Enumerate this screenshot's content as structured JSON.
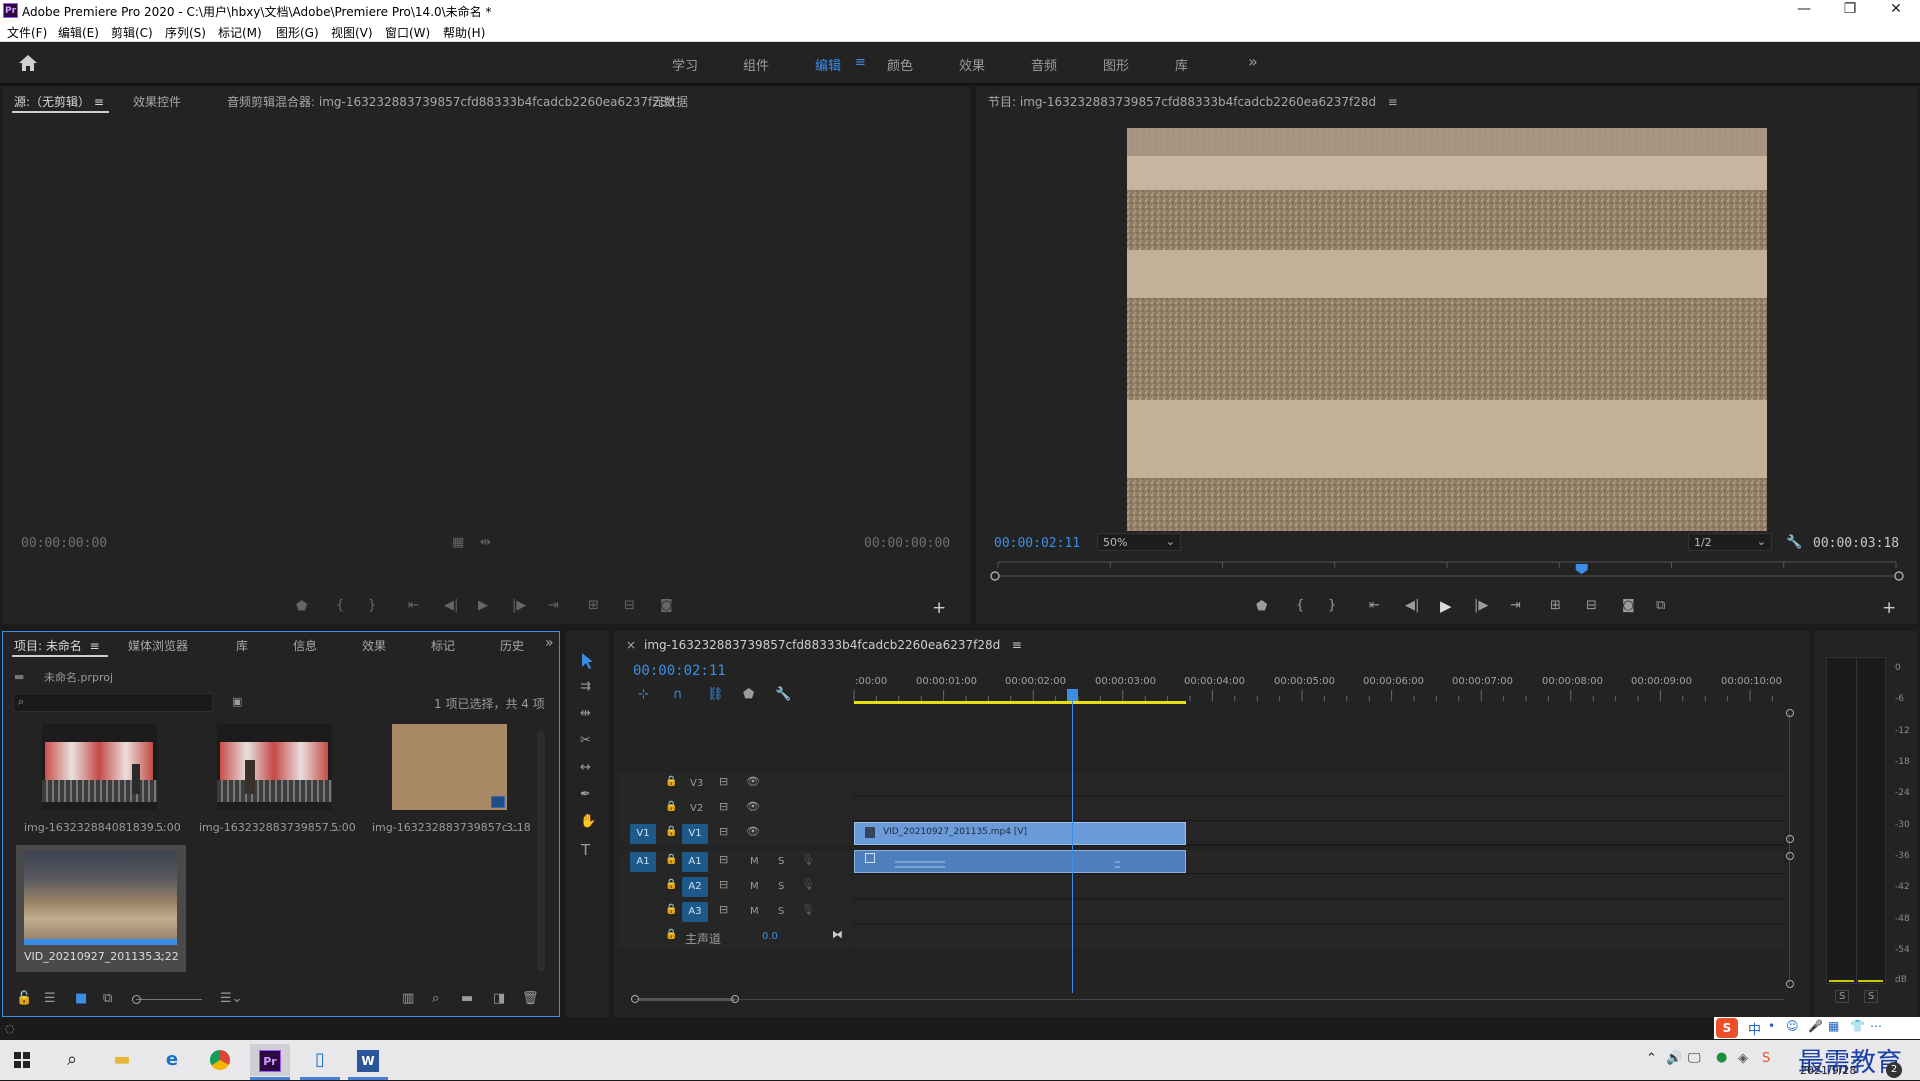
{
  "window": {
    "title": "Adobe Premiere Pro 2020 - C:\\用户\\hbxy\\文档\\Adobe\\Premiere Pro\\14.0\\未命名 *",
    "logo": "Pr",
    "minimize": "—",
    "restore": "❐",
    "close": "✕"
  },
  "menu": [
    "文件(F)",
    "编辑(E)",
    "剪辑(C)",
    "序列(S)",
    "标记(M)",
    "图形(G)",
    "视图(V)",
    "窗口(W)",
    "帮助(H)"
  ],
  "workspaces": [
    "学习",
    "组件",
    "编辑",
    "颜色",
    "效果",
    "音频",
    "图形",
    "库"
  ],
  "workspace_active": "编辑",
  "workspace_menu_icon": "≡",
  "workspace_more": "»",
  "source_panel": {
    "tabs": [
      "源:（无剪辑）",
      "效果控件",
      "音频剪辑混合器: img-163232883739857cfd88333b4fcadcb2260ea6237f28d",
      "元数据"
    ],
    "tab_menu": "≡",
    "tc_left": "00:00:00:00",
    "tc_right": "00:00:00:00"
  },
  "program_panel": {
    "title": "节目: img-163232883739857cfd88333b4fcadcb2260ea6237f28d",
    "title_menu": "≡",
    "tc_current": "00:00:02:11",
    "zoom": "50%",
    "resolution": "1/2",
    "tc_duration": "00:00:03:18",
    "playhead_fraction": 0.65
  },
  "project_panel": {
    "tabs": [
      "项目: 未命名",
      "媒体浏览器",
      "库",
      "信息",
      "效果",
      "标记",
      "历史"
    ],
    "tab_menu": "≡",
    "more": "»",
    "project_file": "未命名.prproj",
    "search_placeholder": "",
    "selection_info": "1 项已选择，共 4 项",
    "items": [
      {
        "name": "img-163232884081839...",
        "duration": "5:00"
      },
      {
        "name": "img-163232883739857...",
        "duration": "5:00"
      },
      {
        "name": "img-163232883739857c...",
        "duration": "3:18"
      },
      {
        "name": "VID_20210927_201135...",
        "duration": "3;22"
      }
    ]
  },
  "timeline": {
    "close": "×",
    "sequence_name": "img-163232883739857cfd88333b4fcadcb2260ea6237f28d",
    "menu": "≡",
    "tc_current": "00:00:02:11",
    "ruler": [
      ":00:00",
      "00:00:01:00",
      "00:00:02:00",
      "00:00:03:00",
      "00:00:04:00",
      "00:00:05:00",
      "00:00:06:00",
      "00:00:07:00",
      "00:00:08:00",
      "00:00:09:00",
      "00:00:10:00"
    ],
    "video_tracks": [
      {
        "src": "",
        "name": "V3"
      },
      {
        "src": "",
        "name": "V2"
      },
      {
        "src": "V1",
        "name": "V1"
      }
    ],
    "audio_tracks": [
      {
        "src": "A1",
        "name": "A1",
        "m": "M",
        "s": "S"
      },
      {
        "src": "",
        "name": "A2",
        "m": "M",
        "s": "S"
      },
      {
        "src": "",
        "name": "A3",
        "m": "M",
        "s": "S"
      }
    ],
    "master_label": "主声道",
    "master_value": "0.0",
    "clip_name": "VID_20210927_201135.mp4 [V]"
  },
  "audio_meter": {
    "scale": [
      "0",
      "-6",
      "-12",
      "-18",
      "-24",
      "-30",
      "-36",
      "-42",
      "-48",
      "-54",
      "dB"
    ],
    "solo_left": "S",
    "solo_right": "S"
  },
  "ime": {
    "items": [
      "中",
      "•",
      "☺",
      "🎤",
      "▦",
      "👕",
      "⋯"
    ],
    "brand": "最需教育"
  },
  "taskbar": {
    "date": "2021/9/28",
    "notification_count": "2"
  },
  "colors": {
    "accent_blue": "#3b8de6",
    "clip_video": "#6b9bd8",
    "clip_audio": "#4d7fbf",
    "work_area": "#e8e000"
  }
}
